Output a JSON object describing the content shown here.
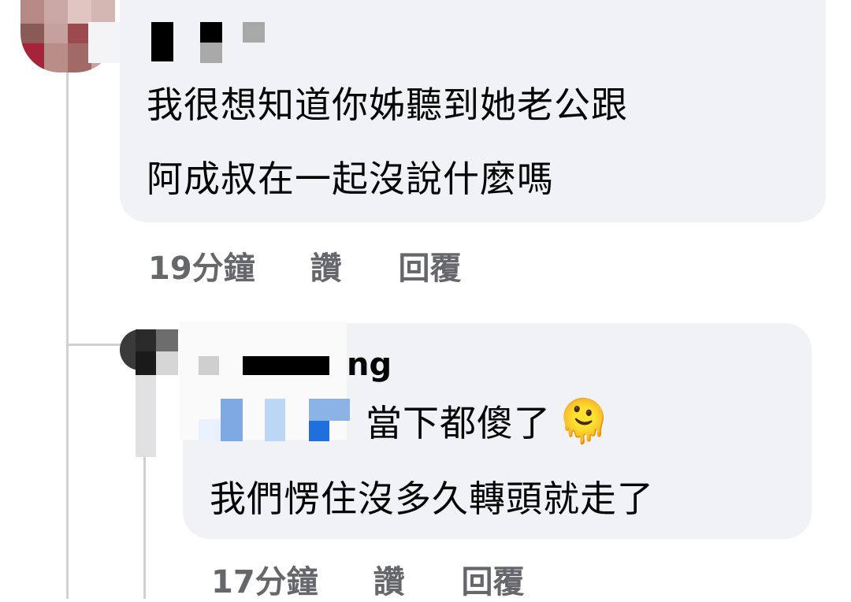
{
  "comments": [
    {
      "text_line1": "我很想知道你姊聽到她老公跟",
      "text_line2": "阿成叔在一起沒說什麼嗎",
      "time": "19分鐘",
      "like_label": "讚",
      "reply_label": "回覆"
    },
    {
      "author_visible_suffix": "ng",
      "text_line1": "當下都傻了",
      "text_line2": "我們愣住沒多久轉頭就走了",
      "emoji": "🫠",
      "time": "17分鐘",
      "like_label": "讚",
      "reply_label": "回覆"
    }
  ],
  "colors": {
    "bubble": "#f0f2f5",
    "meta_text": "#65676b",
    "thread_line": "#ced0d4",
    "mention_blue": "#216fdb"
  }
}
